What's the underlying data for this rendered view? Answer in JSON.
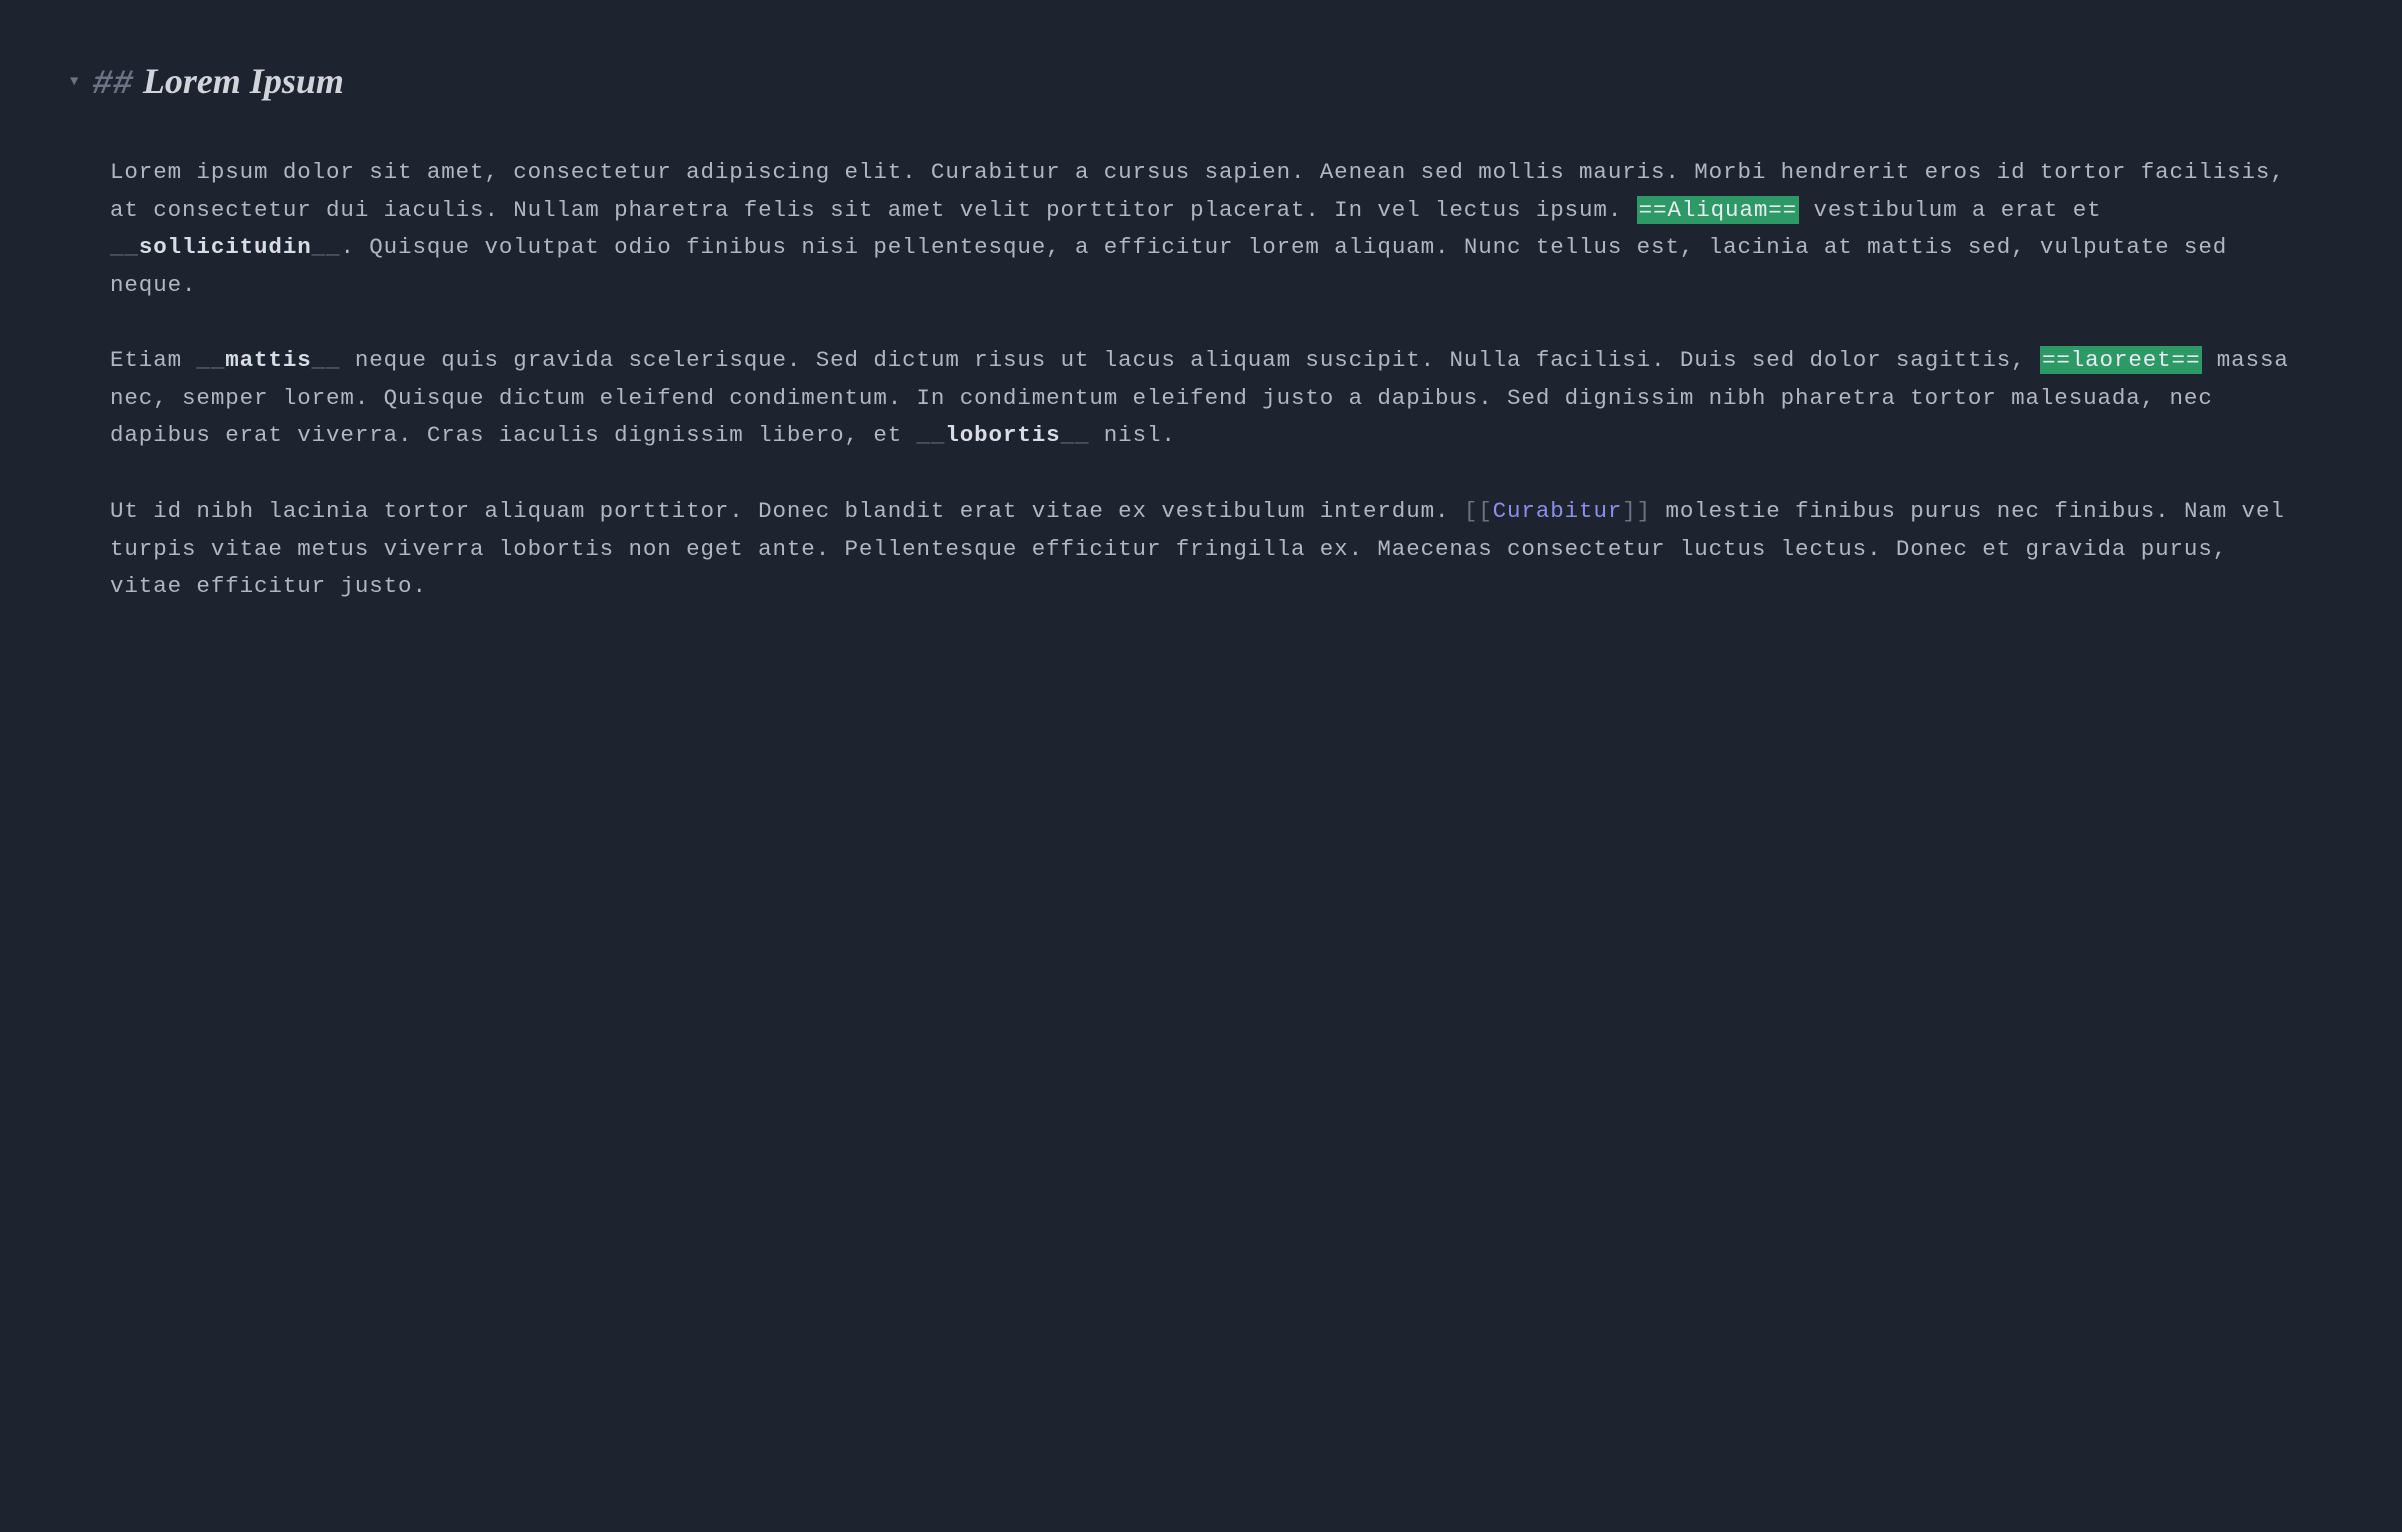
{
  "heading": {
    "markers": "##",
    "title": "Lorem Ipsum"
  },
  "paragraphs": {
    "p1": {
      "seg1": "Lorem ipsum dolor sit amet, consectetur adipiscing elit. Curabitur a cursus sapien. Aenean sed mollis mauris. Morbi hendrerit eros id tortor facilisis, at consectetur dui iaculis. Nullam pharetra felis sit amet velit porttitor placerat. In vel lectus ipsum. ",
      "hl1": "==Aliquam==",
      "seg2": " vestibulum a erat et ",
      "bold1_marker_open": "__",
      "bold1_text": "sollicitudin",
      "bold1_marker_close": "__",
      "seg3": ". Quisque volutpat odio finibus nisi pellentesque, a efficitur lorem aliquam. Nunc tellus est, lacinia at mattis sed, vulputate sed neque."
    },
    "p2": {
      "seg1": "Etiam ",
      "bold1_marker_open": "__",
      "bold1_text": "mattis",
      "bold1_marker_close": "__",
      "seg2": " neque quis gravida scelerisque. Sed dictum risus ut lacus aliquam suscipit. Nulla facilisi. Duis sed dolor sagittis, ",
      "hl1": "==laoreet==",
      "seg3": " massa nec, semper lorem. Quisque dictum eleifend condimentum. In condimentum eleifend justo a dapibus. Sed dignissim nibh pharetra tortor malesuada, nec dapibus erat viverra. Cras iaculis dignissim libero, et ",
      "bold2_marker_open": "__",
      "bold2_text": "lobortis",
      "bold2_marker_close": "__",
      "seg4": " nisl."
    },
    "p3": {
      "seg1": "Ut id nibh lacinia tortor aliquam porttitor. Donec blandit erat vitae ex vestibulum interdum. ",
      "link_open": "[[",
      "link_text": "Curabitur",
      "link_close": "]]",
      "seg2": " molestie finibus purus nec finibus. Nam vel turpis vitae metus viverra lobortis non eget ante. Pellentesque efficitur fringilla ex. Maecenas consectetur luctus lectus. Donec et gravida purus, vitae efficitur justo."
    }
  },
  "fold_arrow": "▼"
}
